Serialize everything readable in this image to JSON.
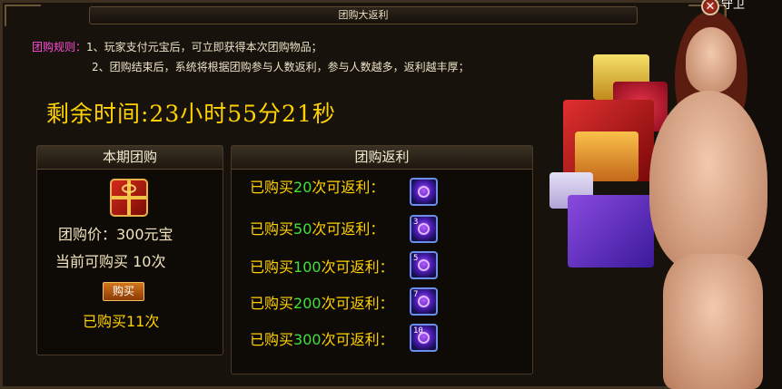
{
  "window": {
    "title": "团购大返利",
    "close_glyph": "✕",
    "partial_label": "守卫"
  },
  "rules": {
    "heading": "团购规则：",
    "line1": "1、玩家支付元宝后，可立即获得本次团购物品；",
    "line2": "2、团购结束后，系统将根据团购参与人数返利，参与人数越多，返利越丰厚；"
  },
  "timer": {
    "text": "剩余时间:23小时55分21秒"
  },
  "current_group": {
    "title": "本期团购",
    "icon": "gift-box-icon",
    "price": "团购价：300元宝",
    "limit": "当前可购买 10次",
    "buy_label": "购买",
    "bought": "已购买11次"
  },
  "rebates": {
    "title": "团购返利",
    "rows": [
      {
        "prefix": "已购买",
        "count": "20",
        "suffix": "次可返利：",
        "badge": ""
      },
      {
        "prefix": "已购买",
        "count": "50",
        "suffix": "次可返利：",
        "badge": "3"
      },
      {
        "prefix": "已购买",
        "count": "100",
        "suffix": "次可返利：",
        "badge": "5"
      },
      {
        "prefix": "已购买",
        "count": "200",
        "suffix": "次可返利：",
        "badge": "7"
      },
      {
        "prefix": "已购买",
        "count": "300",
        "suffix": "次可返利：",
        "badge": "10"
      }
    ],
    "icon": "purple-orb-icon"
  },
  "colors": {
    "accent_gold": "#ffd200",
    "count_green": "#3fe13c",
    "rules_heading": "#ff4fd6"
  }
}
